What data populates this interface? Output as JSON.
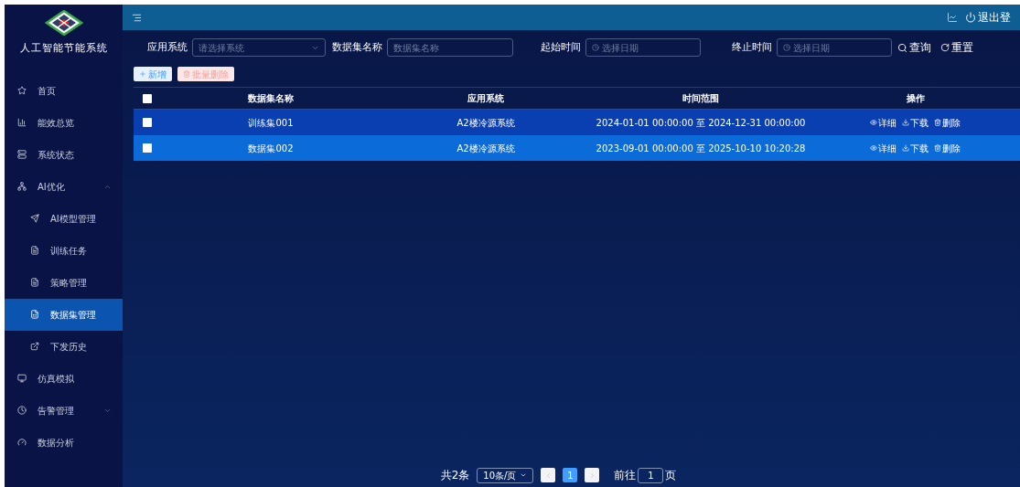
{
  "app": {
    "title": "人工智能节能系统"
  },
  "sidebar": {
    "items": [
      {
        "label": "首页",
        "selected": false
      },
      {
        "label": "能效总览",
        "selected": false
      },
      {
        "label": "系统状态",
        "selected": false
      },
      {
        "label": "AI优化",
        "selected": false,
        "expanded": true,
        "children": [
          {
            "label": "AI模型管理",
            "selected": false
          },
          {
            "label": "训练任务",
            "selected": false
          },
          {
            "label": "策略管理",
            "selected": false
          },
          {
            "label": "数据集管理",
            "selected": true
          },
          {
            "label": "下发历史",
            "selected": false
          }
        ]
      },
      {
        "label": "仿真模拟",
        "selected": false
      },
      {
        "label": "告警管理",
        "selected": false,
        "expanded": false
      },
      {
        "label": "数据分析",
        "selected": false
      }
    ]
  },
  "topbar": {
    "logout": "退出登"
  },
  "filters": [
    {
      "kind": "select",
      "label": "应用系统",
      "placeholder": "请选择系统"
    },
    {
      "kind": "text",
      "label": "数据集名称",
      "placeholder": "数据集名称"
    },
    {
      "kind": "date",
      "label": "起始时间",
      "placeholder": "选择日期"
    },
    {
      "kind": "date",
      "label": "终止时间",
      "placeholder": "选择日期"
    }
  ],
  "search_button": "查询",
  "reset_button": "重置",
  "toolbar": {
    "add": "新增",
    "batch_delete": "批量删除"
  },
  "table": {
    "header_checked": false,
    "columns": [
      "数据集名称",
      "应用系统",
      "时间范围",
      "操作"
    ],
    "rows": [
      {
        "checked": false,
        "cells": [
          "训练集001",
          "A2楼冷源系统",
          "2024-01-01 00:00:00 至 2024-12-31 00:00:00"
        ],
        "actions": [
          "详细",
          "下载",
          "删除"
        ]
      },
      {
        "checked": false,
        "cells": [
          "数据集002",
          "A2楼冷源系统",
          "2023-09-01 00:00:00 至 2025-10-10 10:20:28"
        ],
        "actions": [
          "详细",
          "下载",
          "删除"
        ]
      }
    ]
  },
  "pagination": {
    "total": "共2条",
    "page_size": "10条/页",
    "pages": [
      {
        "label": "1",
        "selected": true
      }
    ],
    "goto_label": "前往",
    "goto_value": "1",
    "goto_suffix": "页"
  }
}
